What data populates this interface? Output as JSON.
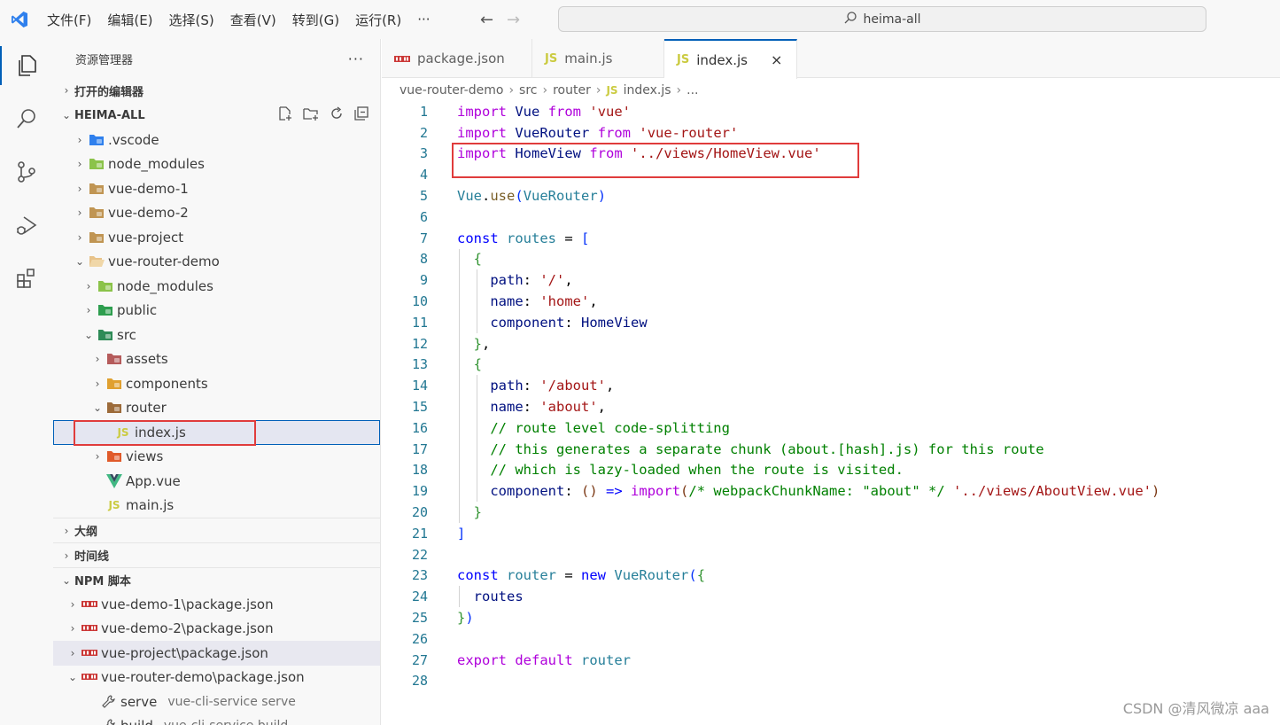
{
  "menu": [
    "文件(F)",
    "编辑(E)",
    "选择(S)",
    "查看(V)",
    "转到(G)",
    "运行(R)",
    "···"
  ],
  "search": {
    "text": "heima-all"
  },
  "explorer": {
    "title": "资源管理器",
    "open_editors": "打开的编辑器",
    "workspace": "HEIMA-ALL",
    "tree": [
      {
        "label": ".vscode",
        "depth": 0,
        "chevron": "›",
        "icon": "vscode-folder-icon",
        "color": "#2f80ed"
      },
      {
        "label": "node_modules",
        "depth": 0,
        "chevron": "›",
        "icon": "node-folder-icon",
        "color": "#8bc34a"
      },
      {
        "label": "vue-demo-1",
        "depth": 0,
        "chevron": "›",
        "icon": "folder-icon",
        "color": "#c09553"
      },
      {
        "label": "vue-demo-2",
        "depth": 0,
        "chevron": "›",
        "icon": "folder-icon",
        "color": "#c09553"
      },
      {
        "label": "vue-project",
        "depth": 0,
        "chevron": "›",
        "icon": "folder-icon",
        "color": "#c09553"
      },
      {
        "label": "vue-router-demo",
        "depth": 0,
        "chevron": "⌄",
        "icon": "folder-open-icon",
        "color": "#e8c38a"
      },
      {
        "label": "node_modules",
        "depth": 1,
        "chevron": "›",
        "icon": "node-folder-icon",
        "color": "#8bc34a"
      },
      {
        "label": "public",
        "depth": 1,
        "chevron": "›",
        "icon": "public-folder-icon",
        "color": "#2e9e4f"
      },
      {
        "label": "src",
        "depth": 1,
        "chevron": "⌄",
        "icon": "src-folder-icon",
        "color": "#2e8b57"
      },
      {
        "label": "assets",
        "depth": 2,
        "chevron": "›",
        "icon": "assets-folder-icon",
        "color": "#b55b5b"
      },
      {
        "label": "components",
        "depth": 2,
        "chevron": "›",
        "icon": "components-folder-icon",
        "color": "#e0a030"
      },
      {
        "label": "router",
        "depth": 2,
        "chevron": "⌄",
        "icon": "router-folder-icon",
        "color": "#9c6b3a"
      },
      {
        "label": "index.js",
        "depth": 3,
        "chevron": "",
        "icon": "js-file-icon",
        "color": "#cbcb41",
        "selected": true
      },
      {
        "label": "views",
        "depth": 2,
        "chevron": "›",
        "icon": "views-folder-icon",
        "color": "#e05a2a"
      },
      {
        "label": "App.vue",
        "depth": 2,
        "chevron": "",
        "icon": "vue-file-icon",
        "color": "#41b883"
      },
      {
        "label": "main.js",
        "depth": 2,
        "chevron": "",
        "icon": "js-file-icon",
        "color": "#cbcb41"
      }
    ],
    "outline": "大纲",
    "timeline": "时间线",
    "npm": "NPM 脚本",
    "npm_items": [
      {
        "label": "vue-demo-1\\package.json",
        "chevron": "›"
      },
      {
        "label": "vue-demo-2\\package.json",
        "chevron": "›"
      },
      {
        "label": "vue-project\\package.json",
        "chevron": "›",
        "hover": true
      },
      {
        "label": "vue-router-demo\\package.json",
        "chevron": "⌄"
      }
    ],
    "scripts": [
      {
        "name": "serve",
        "cmd": "vue-cli-service serve"
      },
      {
        "name": "build",
        "cmd": "vue-cli-service build"
      }
    ]
  },
  "tabs": [
    {
      "label": "package.json",
      "icon": "npm-icon"
    },
    {
      "label": "main.js",
      "icon": "js-icon"
    },
    {
      "label": "index.js",
      "icon": "js-icon",
      "active": true,
      "close": "×"
    }
  ],
  "breadcrumb": [
    "vue-router-demo",
    "src",
    "router",
    "index.js",
    "..."
  ],
  "js_badge": "JS",
  "watermark": "CSDN @清风微凉 aaa"
}
